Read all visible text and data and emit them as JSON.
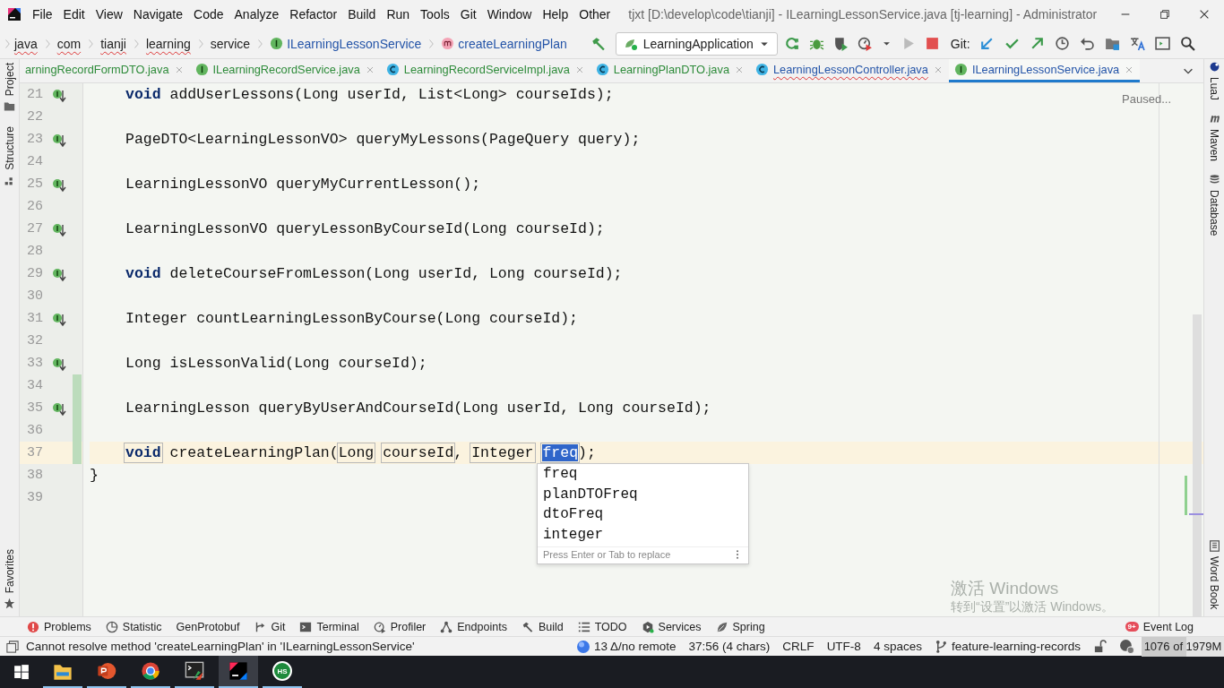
{
  "window": {
    "title": "tjxt [D:\\develop\\code\\tianji] - ILearningLessonService.java [tj-learning] - Administrator"
  },
  "menu": [
    "File",
    "Edit",
    "View",
    "Navigate",
    "Code",
    "Analyze",
    "Refactor",
    "Build",
    "Run",
    "Tools",
    "Git",
    "Window",
    "Help",
    "Other"
  ],
  "breadcrumbs": [
    {
      "label": "java",
      "kind": "folder",
      "misspelled": true
    },
    {
      "label": "com",
      "kind": "folder",
      "misspelled": true
    },
    {
      "label": "tianji",
      "kind": "folder",
      "misspelled": true
    },
    {
      "label": "learning",
      "kind": "folder",
      "misspelled": true
    },
    {
      "label": "service",
      "kind": "folder",
      "misspelled": false
    },
    {
      "label": "ILearningLessonService",
      "kind": "interface",
      "misspelled": false
    },
    {
      "label": "createLearningPlan",
      "kind": "method",
      "misspelled": false
    }
  ],
  "run_config": {
    "label": "LearningApplication"
  },
  "git_label": "Git:",
  "left_tool_windows": {
    "top": [
      "Project",
      "Structure"
    ],
    "bottom": [
      "Favorites"
    ]
  },
  "right_tool_windows": {
    "top": [
      "LuaJ",
      "Maven",
      "Database"
    ],
    "bottom": [
      "Word Book"
    ]
  },
  "tabs": [
    {
      "label": "arningRecordFormDTO.java",
      "kind": "none",
      "color": "#2e8b3a",
      "error": false,
      "selected": false
    },
    {
      "label": "ILearningRecordService.java",
      "kind": "interface",
      "color": "#2e8b3a",
      "error": false,
      "selected": false
    },
    {
      "label": "LearningRecordServiceImpl.java",
      "kind": "class",
      "color": "#2e8b3a",
      "error": false,
      "selected": false
    },
    {
      "label": "LearningPlanDTO.java",
      "kind": "class",
      "color": "#2e8b3a",
      "error": false,
      "selected": false
    },
    {
      "label": "LearningLessonController.java",
      "kind": "class",
      "color": "#2454a8",
      "error": true,
      "selected": false
    },
    {
      "label": "ILearningLessonService.java",
      "kind": "interface",
      "color": "#2454a8",
      "error": false,
      "selected": true
    }
  ],
  "editor": {
    "status": "Paused...",
    "lines": [
      {
        "number": "21",
        "implemented": true,
        "changed": false,
        "current": false,
        "tokens": [
          {
            "text": "void",
            "kind": "keyword"
          },
          {
            "text": " addUserLessons(Long userId, List<Long> courseIds);",
            "kind": "plain"
          }
        ]
      },
      {
        "number": "22",
        "implemented": false,
        "changed": false,
        "current": false
      },
      {
        "number": "23",
        "implemented": true,
        "changed": false,
        "current": false,
        "tokens": [
          {
            "text": "PageDTO<LearningLessonVO> queryMyLessons(PageQuery query);",
            "kind": "plain"
          }
        ]
      },
      {
        "number": "24",
        "implemented": false,
        "changed": false,
        "current": false
      },
      {
        "number": "25",
        "implemented": true,
        "changed": false,
        "current": false,
        "tokens": [
          {
            "text": "LearningLessonVO queryMyCurrentLesson();",
            "kind": "plain"
          }
        ]
      },
      {
        "number": "26",
        "implemented": false,
        "changed": false,
        "current": false
      },
      {
        "number": "27",
        "implemented": true,
        "changed": false,
        "current": false,
        "tokens": [
          {
            "text": "LearningLessonVO queryLessonByCourseId(Long courseId);",
            "kind": "plain"
          }
        ]
      },
      {
        "number": "28",
        "implemented": false,
        "changed": false,
        "current": false
      },
      {
        "number": "29",
        "implemented": true,
        "changed": false,
        "current": false,
        "tokens": [
          {
            "text": "void",
            "kind": "keyword"
          },
          {
            "text": " deleteCourseFromLesson(Long userId, Long courseId);",
            "kind": "plain"
          }
        ]
      },
      {
        "number": "30",
        "implemented": false,
        "changed": false,
        "current": false
      },
      {
        "number": "31",
        "implemented": true,
        "changed": false,
        "current": false,
        "tokens": [
          {
            "text": "Integer countLearningLessonByCourse(Long courseId);",
            "kind": "plain"
          }
        ]
      },
      {
        "number": "32",
        "implemented": false,
        "changed": false,
        "current": false
      },
      {
        "number": "33",
        "implemented": true,
        "changed": false,
        "current": false,
        "tokens": [
          {
            "text": "Long isLessonValid(Long courseId);",
            "kind": "plain"
          }
        ]
      },
      {
        "number": "34",
        "implemented": false,
        "changed": true,
        "current": false
      },
      {
        "number": "35",
        "implemented": true,
        "changed": true,
        "current": false,
        "tokens": [
          {
            "text": "LearningLesson queryByUserAndCourseId(Long userId, Long courseId);",
            "kind": "plain"
          }
        ]
      },
      {
        "number": "36",
        "implemented": false,
        "changed": true,
        "current": false
      },
      {
        "number": "37",
        "implemented": false,
        "changed": true,
        "current": true,
        "tokens": [
          {
            "text": "void",
            "kind": "boxed-keyword"
          },
          {
            "text": " createLearningPlan(",
            "kind": "plain"
          },
          {
            "text": "Long",
            "kind": "template",
            "space_after": true
          },
          {
            "text": "courseId",
            "kind": "template"
          },
          {
            "text": ", ",
            "kind": "plain"
          },
          {
            "text": "Integer",
            "kind": "template",
            "space_after": true
          },
          {
            "text": "freq",
            "kind": "selected"
          },
          {
            "text": ");",
            "kind": "plain"
          }
        ]
      },
      {
        "number": "38",
        "implemented": false,
        "changed": false,
        "current": false,
        "kind": "closing",
        "tokens": [
          {
            "text": "}",
            "kind": "plain"
          }
        ]
      },
      {
        "number": "39",
        "implemented": false,
        "changed": false,
        "current": false
      }
    ],
    "completion": {
      "items": [
        {
          "label": "freq",
          "selected": false
        },
        {
          "label": "planDTOFreq",
          "selected": false
        },
        {
          "label": "dtoFreq",
          "selected": false
        },
        {
          "label": "integer",
          "selected": false
        }
      ],
      "hint": "Press Enter or Tab to replace"
    },
    "activation_notice": {
      "title": "激活 Windows",
      "subtitle": "转到“设置”以激活 Windows。"
    }
  },
  "tool_windows": [
    {
      "label": "Problems",
      "kind": "problems"
    },
    {
      "label": "Statistic",
      "kind": "statistic"
    },
    {
      "label": "GenProtobuf",
      "kind": "none"
    },
    {
      "label": "Git",
      "kind": "git"
    },
    {
      "label": "Terminal",
      "kind": "terminal"
    },
    {
      "label": "Profiler",
      "kind": "profiler"
    },
    {
      "label": "Endpoints",
      "kind": "endpoints"
    },
    {
      "label": "Build",
      "kind": "build"
    },
    {
      "label": "TODO",
      "kind": "todo"
    },
    {
      "label": "Services",
      "kind": "services"
    },
    {
      "label": "Spring",
      "kind": "spring"
    }
  ],
  "event_log": {
    "label": "Event Log",
    "badge": "9+"
  },
  "status_bar": {
    "message": "Cannot resolve method 'createLearningPlan' in 'ILearningLessonService'",
    "vcs": "13 Δ/no remote",
    "position": "37:56 (4 chars)",
    "line_separator": "CRLF",
    "encoding": "UTF-8",
    "indent": "4 spaces",
    "branch": "feature-learning-records",
    "memory": {
      "text": "1076 of 1979M",
      "level": 0.54
    }
  },
  "taskbar": [
    {
      "kind": "explorer",
      "running": true,
      "selected": false
    },
    {
      "kind": "powerpoint",
      "running": true,
      "selected": false
    },
    {
      "kind": "chrome",
      "running": true,
      "selected": false
    },
    {
      "kind": "terminal",
      "running": true,
      "selected": false
    },
    {
      "kind": "intellij",
      "running": true,
      "selected": true
    },
    {
      "kind": "hs",
      "label": "HS",
      "running": true,
      "selected": false
    }
  ]
}
